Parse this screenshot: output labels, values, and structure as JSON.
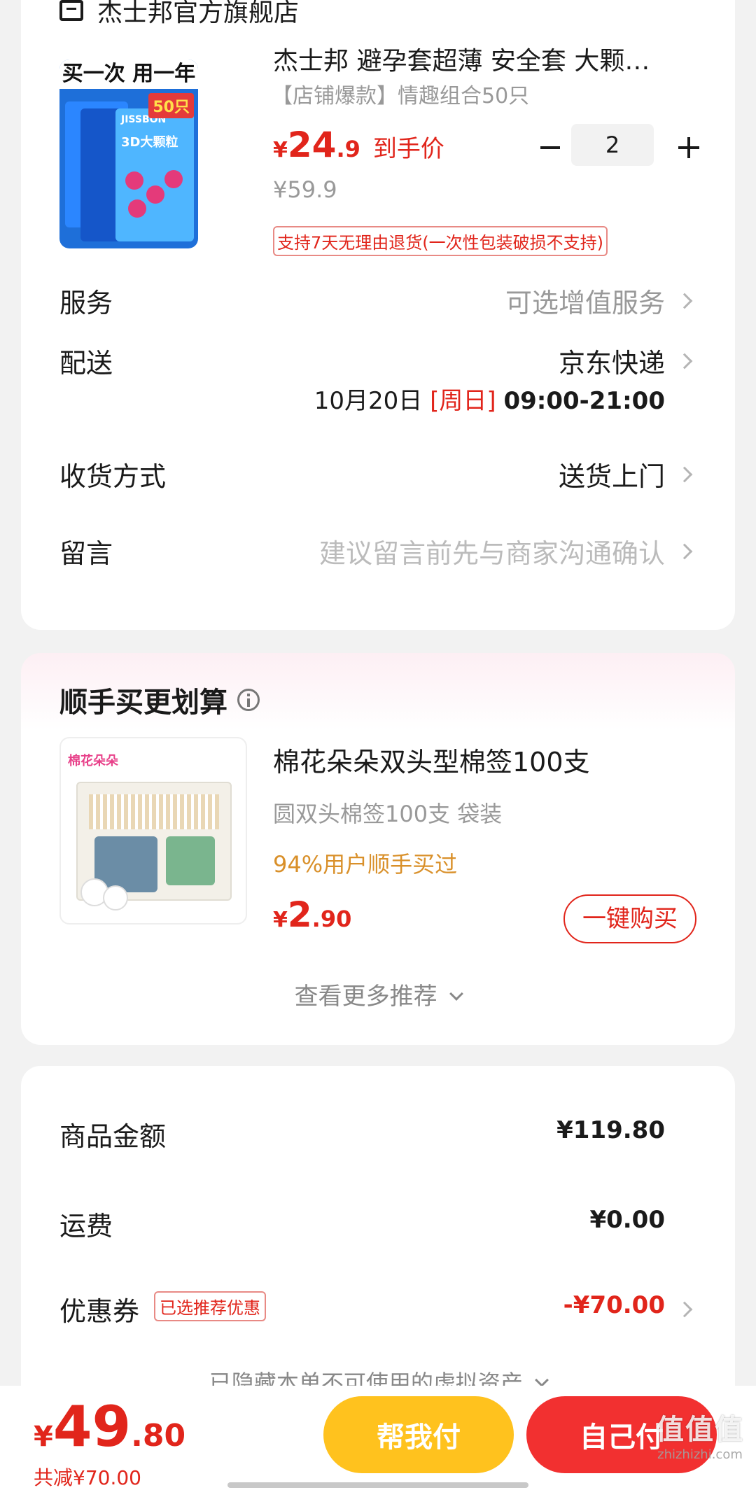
{
  "store": {
    "name": "杰士邦官方旗舰店"
  },
  "product": {
    "title": "杰士邦 避孕套超薄 安全套 大颗…",
    "spec": "【店铺爆款】情趣组合50只",
    "price_symbol": "¥",
    "price_int": "24",
    "price_dec": ".9",
    "price_tag": "到手价",
    "original_price": "¥59.9",
    "return_policy": "支持7天无理由退货(一次性包装破损不支持)",
    "quantity": "2",
    "image_banner": "买一次 用一年",
    "image_badge": "50只",
    "image_box_label": "3D大颗粒",
    "image_box_brand": "JISSBON"
  },
  "rows": {
    "service_label": "服务",
    "service_value": "可选增值服务",
    "delivery_label": "配送",
    "delivery_value": "京东快递",
    "delivery_date": "10月20日",
    "delivery_weekday": "[周日]",
    "delivery_time": "09:00-21:00",
    "receive_label": "收货方式",
    "receive_value": "送货上门",
    "message_label": "留言",
    "message_placeholder": "建议留言前先与商家沟通确认"
  },
  "recommend": {
    "title": "顺手买更划算",
    "item_title": "棉花朵朵双头型棉签100支",
    "item_spec": "圆双头棉签100支 袋装",
    "item_hint": "94%用户顺手买过",
    "price_symbol": "¥",
    "price_int": "2",
    "price_dec": ".90",
    "buy_button": "一键购买",
    "more": "查看更多推荐",
    "image_brand": "棉花朵朵"
  },
  "summary": {
    "goods_label": "商品金额",
    "goods_value": "¥119.80",
    "shipping_label": "运费",
    "shipping_value": "¥0.00",
    "coupon_label": "优惠券",
    "coupon_badge": "已选推荐优惠",
    "coupon_value": "-¥70.00",
    "hidden_assets": "已隐藏本单不可使用的虚拟资产"
  },
  "footer": {
    "total_symbol": "¥",
    "total_int": "49",
    "total_dec": ".80",
    "discount": "共减¥70.00",
    "help_pay": "帮我付",
    "self_pay": "自己付"
  },
  "watermark": {
    "text": "值值值",
    "site": "zhizhizhi.com"
  },
  "colors": {
    "accent_red": "#e1251b",
    "coupon_red": "#e1251b",
    "help_yellow": "#ffc21e",
    "self_red": "#f23030",
    "muted": "#999999"
  }
}
